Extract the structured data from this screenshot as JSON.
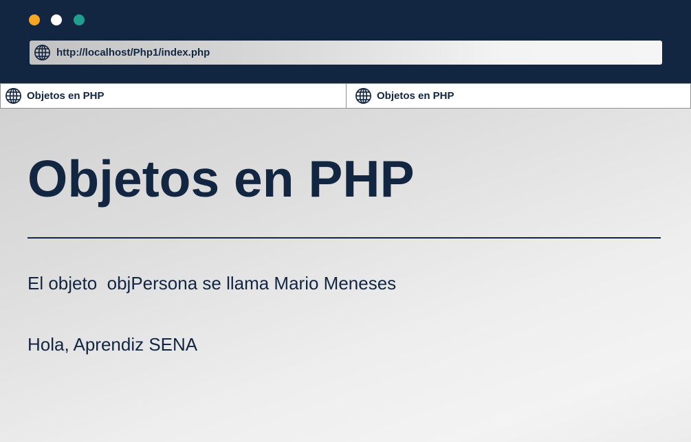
{
  "window": {
    "dots": [
      {
        "name": "orange-dot",
        "color": "#f5a623"
      },
      {
        "name": "white-dot",
        "color": "#ffffff"
      },
      {
        "name": "teal-dot",
        "color": "#1f9e8e"
      }
    ]
  },
  "address_bar": {
    "url": "http://localhost/Php1/index.php",
    "icon": "globe-icon"
  },
  "tabs": [
    {
      "label": "Objetos en PHP",
      "icon": "globe-icon"
    },
    {
      "label": "Objetos en PHP",
      "icon": "globe-icon"
    }
  ],
  "main": {
    "title": "Objetos en PHP",
    "lines": [
      "El objeto  objPersona se llama Mario Meneses",
      "Hola, Aprendiz SENA"
    ]
  },
  "colors": {
    "chrome": "#132641",
    "text": "#132641"
  }
}
